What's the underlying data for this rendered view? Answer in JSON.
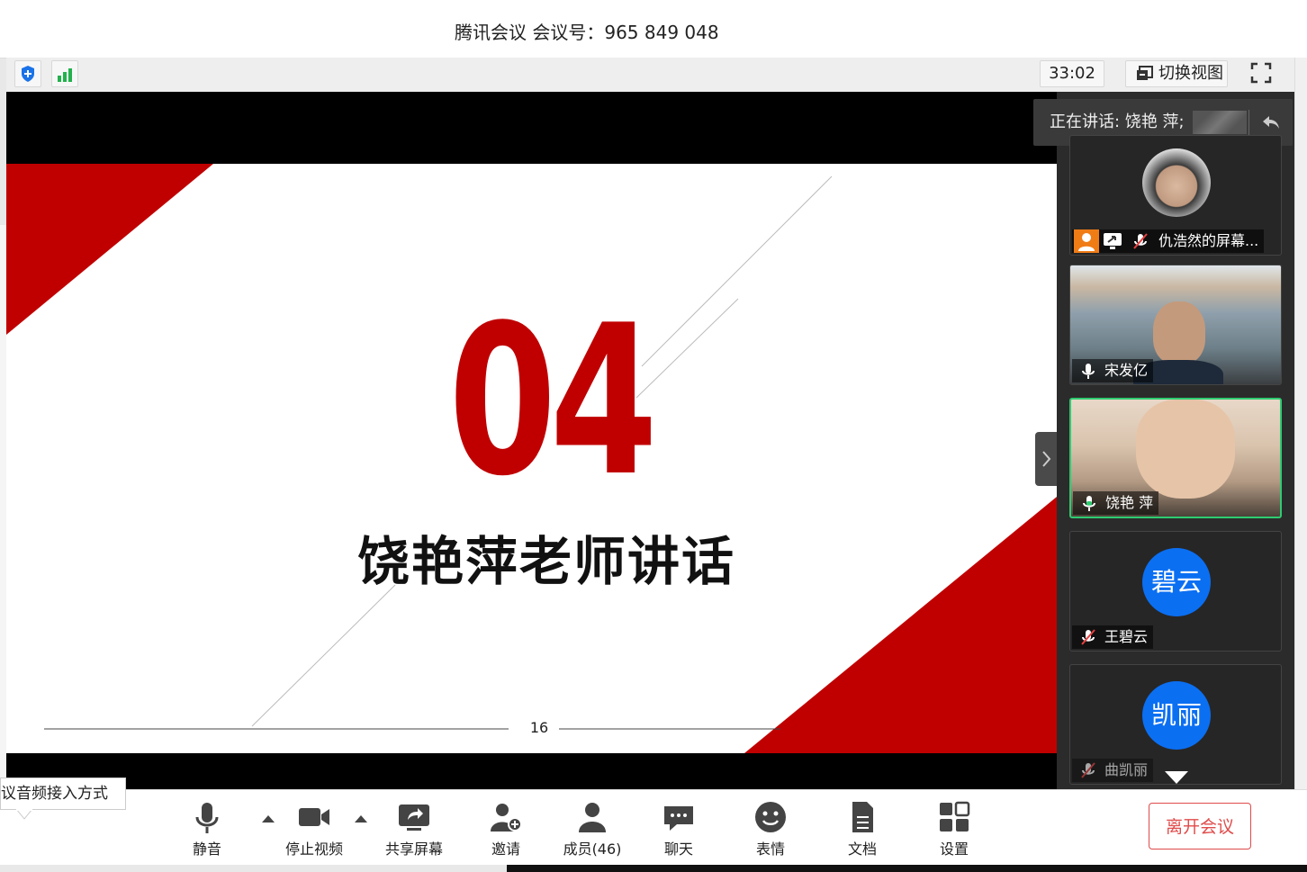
{
  "titlebar": {
    "title": "腾讯会议 会议号：965 849 048"
  },
  "toolbar": {
    "timer": "33:02",
    "switch_view_label": "切换视图"
  },
  "slide": {
    "big_number": "04",
    "heading": "饶艳萍老师讲话",
    "page_number": "16"
  },
  "speaking": {
    "label": "正在讲话: 饶艳 萍;"
  },
  "participants": [
    {
      "name": "仇浩然的屏幕...",
      "avatar_text": "",
      "mic": "muted",
      "kind": "photo"
    },
    {
      "name": "宋发亿",
      "avatar_text": "",
      "mic": "on",
      "kind": "video"
    },
    {
      "name": "饶艳 萍",
      "avatar_text": "",
      "mic": "active",
      "kind": "video"
    },
    {
      "name": "王碧云",
      "avatar_text": "碧云",
      "mic": "muted",
      "kind": "avatar"
    },
    {
      "name": "曲凯丽",
      "avatar_text": "凯丽",
      "mic": "muted",
      "kind": "avatar"
    }
  ],
  "bottombar": {
    "mute_label": "静音",
    "stop_video_label": "停止视频",
    "share_screen_label": "共享屏幕",
    "invite_label": "邀请",
    "members_label": "成员(46)",
    "chat_label": "聊天",
    "emoji_label": "表情",
    "docs_label": "文档",
    "settings_label": "设置",
    "leave_label": "离开会议"
  },
  "audio_tip": "议音频接入方式",
  "colors": {
    "accent_red": "#c00000",
    "leave_red": "#e04b4b",
    "avatar_blue": "#0b6ff2",
    "active_green": "#2ecc71"
  }
}
